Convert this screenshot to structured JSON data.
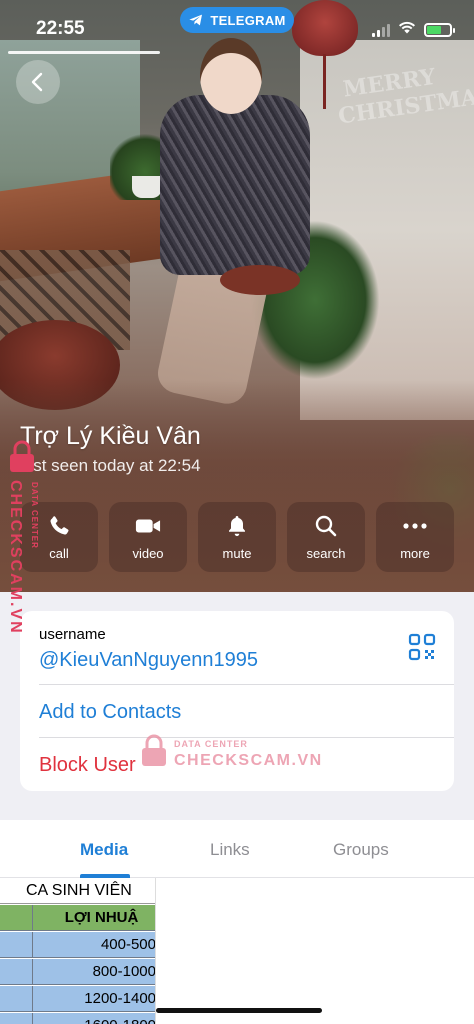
{
  "status_bar": {
    "time": "22:55",
    "app_pill": "TELEGRAM",
    "battery_level": 0.65
  },
  "profile": {
    "name": "Trợ Lý Kiều Vân",
    "last_seen": "last seen today at 22:54"
  },
  "actions": [
    {
      "label": "call",
      "icon": "phone-icon"
    },
    {
      "label": "video",
      "icon": "video-camera-icon"
    },
    {
      "label": "mute",
      "icon": "bell-icon"
    },
    {
      "label": "search",
      "icon": "search-icon"
    },
    {
      "label": "more",
      "icon": "ellipsis-icon"
    }
  ],
  "info": {
    "username_label": "username",
    "username_value": "@KieuVanNguyenn1995",
    "add_to_contacts": "Add to Contacts",
    "block_user": "Block User"
  },
  "tabs": [
    {
      "label": "Media",
      "active": true
    },
    {
      "label": "Links",
      "active": false
    },
    {
      "label": "Groups",
      "active": false
    }
  ],
  "media_thumbnail": {
    "title": "CA SINH VIÊN",
    "header": "LỢI NHUẬ",
    "rows": [
      "400-500",
      "800-1000",
      "1200-1400",
      "1600-1800"
    ]
  },
  "watermark": {
    "sub": "DATA CENTER",
    "brand": "CHECKSCAM.VN",
    "brand_vertical": "CHECKSCAM.VN"
  },
  "colors": {
    "accent": "#1f7fd6",
    "danger": "#e0323e",
    "telegram_pill": "#2a8ee6",
    "watermark": "#e0405f"
  }
}
